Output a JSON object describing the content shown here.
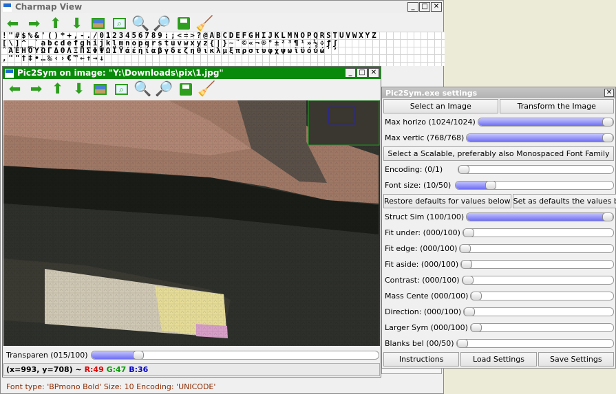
{
  "charmap": {
    "title": "Charmap View",
    "rows": [
      "!\"#$%&'()*+,-./0123456789:;<=>?@ABCDEFGHIJKLMNOPQRSTUVWXYZ",
      "[\\]^_`abcdefghijklmnopqrstuvwxyz{|}~¨©«¬®°±²³¶¹»½÷ƒʃ",
      "ˆΆΈΉΌΎΏΓΔΘΛΞΠΣΦΨΩΪΫάέήίαβγδεζηθικλμξπρστυφχψωϊϋόύώʹʼ",
      ",\"\"†‡•…‰‹›€™←↑→↓"
    ],
    "status": "Font type: 'BPmono Bold' Size: 10 Encoding: 'UNICODE'"
  },
  "toolbar_icons": [
    "arrow-left-icon",
    "arrow-right-icon",
    "arrow-up-icon",
    "arrow-down-icon",
    "image-icon",
    "zoom-fit-icon",
    "zoom-in-icon",
    "zoom-out-icon",
    "save-icon",
    "broom-icon"
  ],
  "pic2sym": {
    "title": "Pic2Sym on image: \"Y:\\Downloads\\pix\\1.jpg\"",
    "transparency_label": "Transparen (015/100)",
    "transparency": 0.15,
    "coords": "(x=993, y=708) ~ ",
    "r": "R:49",
    "g": "G:47",
    "b": "B:36",
    "colors": {
      "titlebar": "#0a8a0a",
      "r": "#e00000",
      "g": "#00a000",
      "b": "#0000d0"
    }
  },
  "settings": {
    "title": "Pic2Sym.exe settings",
    "select_image": "Select an Image",
    "transform_image": "Transform the Image",
    "select_font": "Select a Scalable, preferably also Monospaced Font Family",
    "restore_defaults": "Restore defaults for values below",
    "set_defaults": "Set as defaults the values below",
    "instructions": "Instructions",
    "load_settings": "Load Settings",
    "save_settings": "Save Settings",
    "sliders": {
      "max_horizo": {
        "label": "Max horizo (1024/1024)",
        "value": 1.0
      },
      "max_vertic": {
        "label": "Max vertic (768/768)",
        "value": 1.0
      },
      "encoding": {
        "label": "Encoding:  (0/1)",
        "value": 0.0
      },
      "font_size": {
        "label": "Font size: (10/50)",
        "value": 0.2
      },
      "struct_sim": {
        "label": "Struct Sim (100/100)",
        "value": 1.0
      },
      "fit_under": {
        "label": "Fit under:  (000/100)",
        "value": 0.0
      },
      "fit_edge": {
        "label": "Fit edge:  (000/100)",
        "value": 0.0
      },
      "fit_aside": {
        "label": "Fit aside: (000/100)",
        "value": 0.0
      },
      "contrast": {
        "label": "Contrast:  (000/100)",
        "value": 0.0
      },
      "mass_cente": {
        "label": "Mass Cente (000/100)",
        "value": 0.0
      },
      "direction": {
        "label": "Direction: (000/100)",
        "value": 0.0
      },
      "larger_sym": {
        "label": "Larger Sym (000/100)",
        "value": 0.0
      },
      "blanks_bel": {
        "label": "Blanks bel (00/50)",
        "value": 0.0
      }
    }
  }
}
